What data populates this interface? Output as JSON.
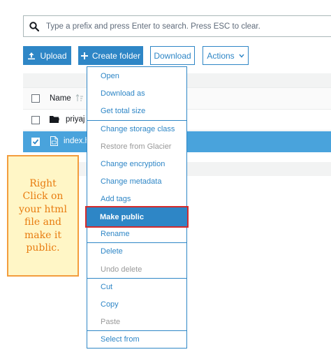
{
  "search": {
    "placeholder": "Type a prefix and press Enter to search. Press ESC to clear.",
    "icon": "search-icon"
  },
  "toolbar": {
    "upload_label": "Upload",
    "create_folder_label": "Create folder",
    "download_label": "Download",
    "actions_label": "Actions",
    "accent_color": "#2e86c6"
  },
  "table": {
    "name_header": "Name",
    "rows": [
      {
        "name": "priyaj",
        "type": "folder",
        "selected": false
      },
      {
        "name": "index.h",
        "type": "file",
        "selected": true
      }
    ],
    "selected_color": "#49a3dc"
  },
  "context_menu": {
    "items": [
      {
        "label": "Open",
        "enabled": true
      },
      {
        "label": "Download as",
        "enabled": true
      },
      {
        "label": "Get total size",
        "enabled": true
      },
      {
        "label": "Change storage class",
        "enabled": true
      },
      {
        "label": "Restore from Glacier",
        "enabled": false
      },
      {
        "label": "Change encryption",
        "enabled": true
      },
      {
        "label": "Change metadata",
        "enabled": true
      },
      {
        "label": "Add tags",
        "enabled": true
      },
      {
        "label": "Make public",
        "enabled": true,
        "highlighted": true
      },
      {
        "label": "Rename",
        "enabled": true
      },
      {
        "label": "Delete",
        "enabled": true
      },
      {
        "label": "Undo delete",
        "enabled": false
      },
      {
        "label": "Cut",
        "enabled": true
      },
      {
        "label": "Copy",
        "enabled": true
      },
      {
        "label": "Paste",
        "enabled": false
      },
      {
        "label": "Select from",
        "enabled": true
      }
    ],
    "highlight_border_color": "#d52b2b"
  },
  "annotation": {
    "text": "Right\nClick on\nyour html\nfile and\nmake it\npublic.",
    "text_color": "#e87c10",
    "border_color": "#f39c3d",
    "background_color": "#fff6c6"
  }
}
